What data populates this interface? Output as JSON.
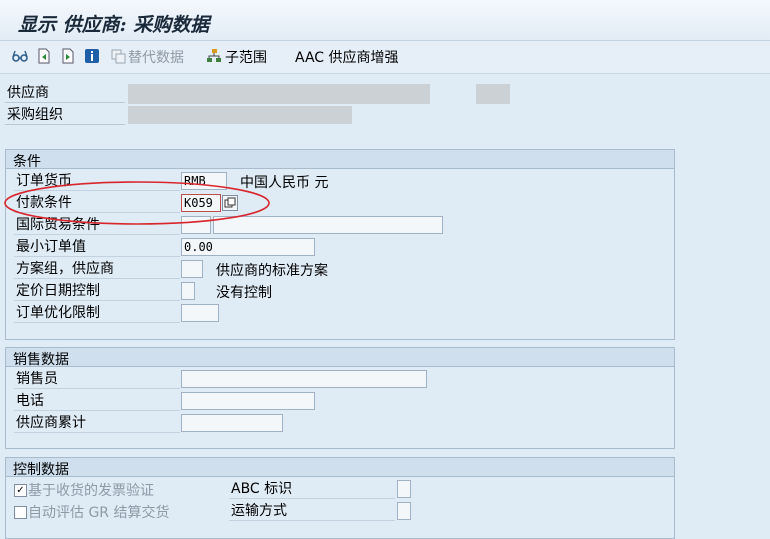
{
  "window": {
    "title": "显示 供应商: 采购数据"
  },
  "toolbar": {
    "items": [
      {
        "name": "glasses-icon"
      },
      {
        "name": "previous-page-icon"
      },
      {
        "name": "next-page-icon"
      },
      {
        "name": "info-icon"
      }
    ],
    "alt_data": "替代数据",
    "sub_range": "子范围",
    "aac": "AAC 供应商增强"
  },
  "header": {
    "vendor_label": "供应商",
    "purch_org_label": "采购组织"
  },
  "conditions": {
    "title": "条件",
    "order_currency": {
      "label": "订单货币",
      "value": "RMB",
      "desc": "中国人民币 元"
    },
    "payment_terms": {
      "label": "付款条件",
      "value": "K059"
    },
    "incoterms": {
      "label": "国际贸易条件",
      "value": "",
      "value2": ""
    },
    "min_order_value": {
      "label": "最小订单值",
      "value": "0.00"
    },
    "schema_group": {
      "label": "方案组，供应商",
      "value": "",
      "desc": "供应商的标准方案"
    },
    "pricing_date_ctrl": {
      "label": "定价日期控制",
      "value": "",
      "desc": "没有控制"
    },
    "order_opt_limit": {
      "label": "订单优化限制",
      "value": ""
    }
  },
  "sales": {
    "title": "销售数据",
    "salesperson": {
      "label": "销售员",
      "value": ""
    },
    "telephone": {
      "label": "电话",
      "value": ""
    },
    "acc_with_vendor": {
      "label": "供应商累计",
      "value": ""
    }
  },
  "control": {
    "title": "控制数据",
    "gr_based_iv": {
      "label": "基于收货的发票验证",
      "checked": true
    },
    "auto_eval_gr": {
      "label": "自动评估 GR 结算交货",
      "checked": false
    },
    "abc_indicator": {
      "label": "ABC 标识",
      "value": ""
    },
    "shipping_mode": {
      "label": "运输方式",
      "value": ""
    }
  },
  "colors": {
    "highlight_ellipse": "#d8262c",
    "background": "#dfebf5"
  }
}
